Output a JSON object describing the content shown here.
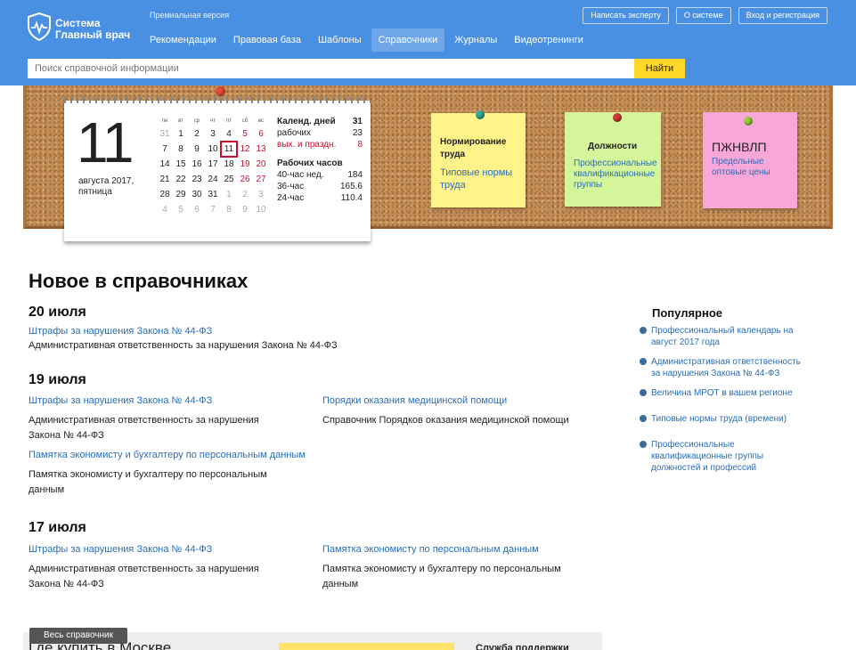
{
  "header": {
    "brand_line1": "Система",
    "brand_line2": "Главный врач",
    "premium": "Премиальная версия",
    "nav": [
      "Рекомендации",
      "Правовая база",
      "Шаблоны",
      "Справочники",
      "Журналы",
      "Видеотренинги"
    ],
    "active_nav": "Справочники",
    "top_buttons": [
      "Написать эксперту",
      "О системе",
      "Вход и регистрация"
    ],
    "search_placeholder": "Поиск справочной информации",
    "search_button": "Найти"
  },
  "calendar": {
    "day": "11",
    "date_text": "августа 2017, пятница",
    "weekdays": [
      "пн",
      "вт",
      "ср",
      "чт",
      "пт",
      "сб",
      "вс"
    ],
    "weeks": [
      [
        "31",
        "1",
        "2",
        "3",
        "4",
        "5",
        "6"
      ],
      [
        "7",
        "8",
        "9",
        "10",
        "11",
        "12",
        "13"
      ],
      [
        "14",
        "15",
        "16",
        "17",
        "18",
        "19",
        "20"
      ],
      [
        "21",
        "22",
        "23",
        "24",
        "25",
        "26",
        "27"
      ],
      [
        "28",
        "29",
        "30",
        "31",
        "1",
        "2",
        "3"
      ],
      [
        "4",
        "5",
        "6",
        "7",
        "8",
        "9",
        "10"
      ]
    ],
    "stats": {
      "cal_days_label": "Календ. дней",
      "cal_days": "31",
      "work_days_label": "рабочих",
      "work_days": "23",
      "holidays_label": "вых. и праздн.",
      "holidays": "8",
      "hours_label": "Рабочих часов",
      "h40_label": "40-час нед.",
      "h40": "184",
      "h36_label": "36-час",
      "h36": "165.6",
      "h24_label": "24-час",
      "h24": "110.4"
    }
  },
  "notes": [
    {
      "title": "Нормирование труда",
      "link": "Типовые нормы труда",
      "color": "#fff38a",
      "pin": "#3aa89a"
    },
    {
      "title": "Должности",
      "link": "Профессиональные квалификационные группы",
      "color": "#d4f59a",
      "pin": "#d23a3a"
    },
    {
      "title": "ПЖНВЛП",
      "link": "Предельные оптовые цены",
      "color": "#f8a8d8",
      "pin": "#9acc3a"
    }
  ],
  "content": {
    "title": "Новое в справочниках",
    "sections": [
      {
        "date": "20 июля",
        "items": [
          {
            "link": "Штрафы за нарушения Закона № 44-ФЗ",
            "desc": "Административная ответственность за нарушения Закона № 44-ФЗ"
          }
        ]
      },
      {
        "date": "19 июля",
        "items": [
          {
            "link": "Штрафы за нарушения Закона № 44-ФЗ",
            "desc": "Административная ответственность за нарушения Закона № 44-ФЗ"
          },
          {
            "link": "Порядки оказания медицинской помощи",
            "desc": "Справочник Порядков оказания медицинской помощи"
          },
          {
            "link": "Памятка экономисту и бухгалтеру по персональным данным",
            "desc": "Памятка экономисту и бухгалтеру по персональным данным"
          }
        ]
      },
      {
        "date": "17 июля",
        "items": [
          {
            "link": "Штрафы за нарушения Закона № 44-ФЗ",
            "desc": "Административная ответственность за нарушения Закона № 44-ФЗ"
          },
          {
            "link": "Памятка экономисту по персональным данным",
            "desc": "Памятка экономисту и бухгалтеру по персональным данным"
          }
        ]
      }
    ]
  },
  "popular": {
    "title": "Популярное",
    "items": [
      "Профессиональный календарь на август 2017 года",
      "Административная ответственность за нарушения Закона № 44-ФЗ",
      "Величина МРОТ в вашем регионе",
      "Типовые нормы труда (времени)",
      "Профессиональные квалификационные группы должностей и профессий"
    ]
  },
  "footer": {
    "all_button": "Весь справочник",
    "where_to_buy": "Где купить в Москве",
    "support": "Служба поддержки"
  }
}
